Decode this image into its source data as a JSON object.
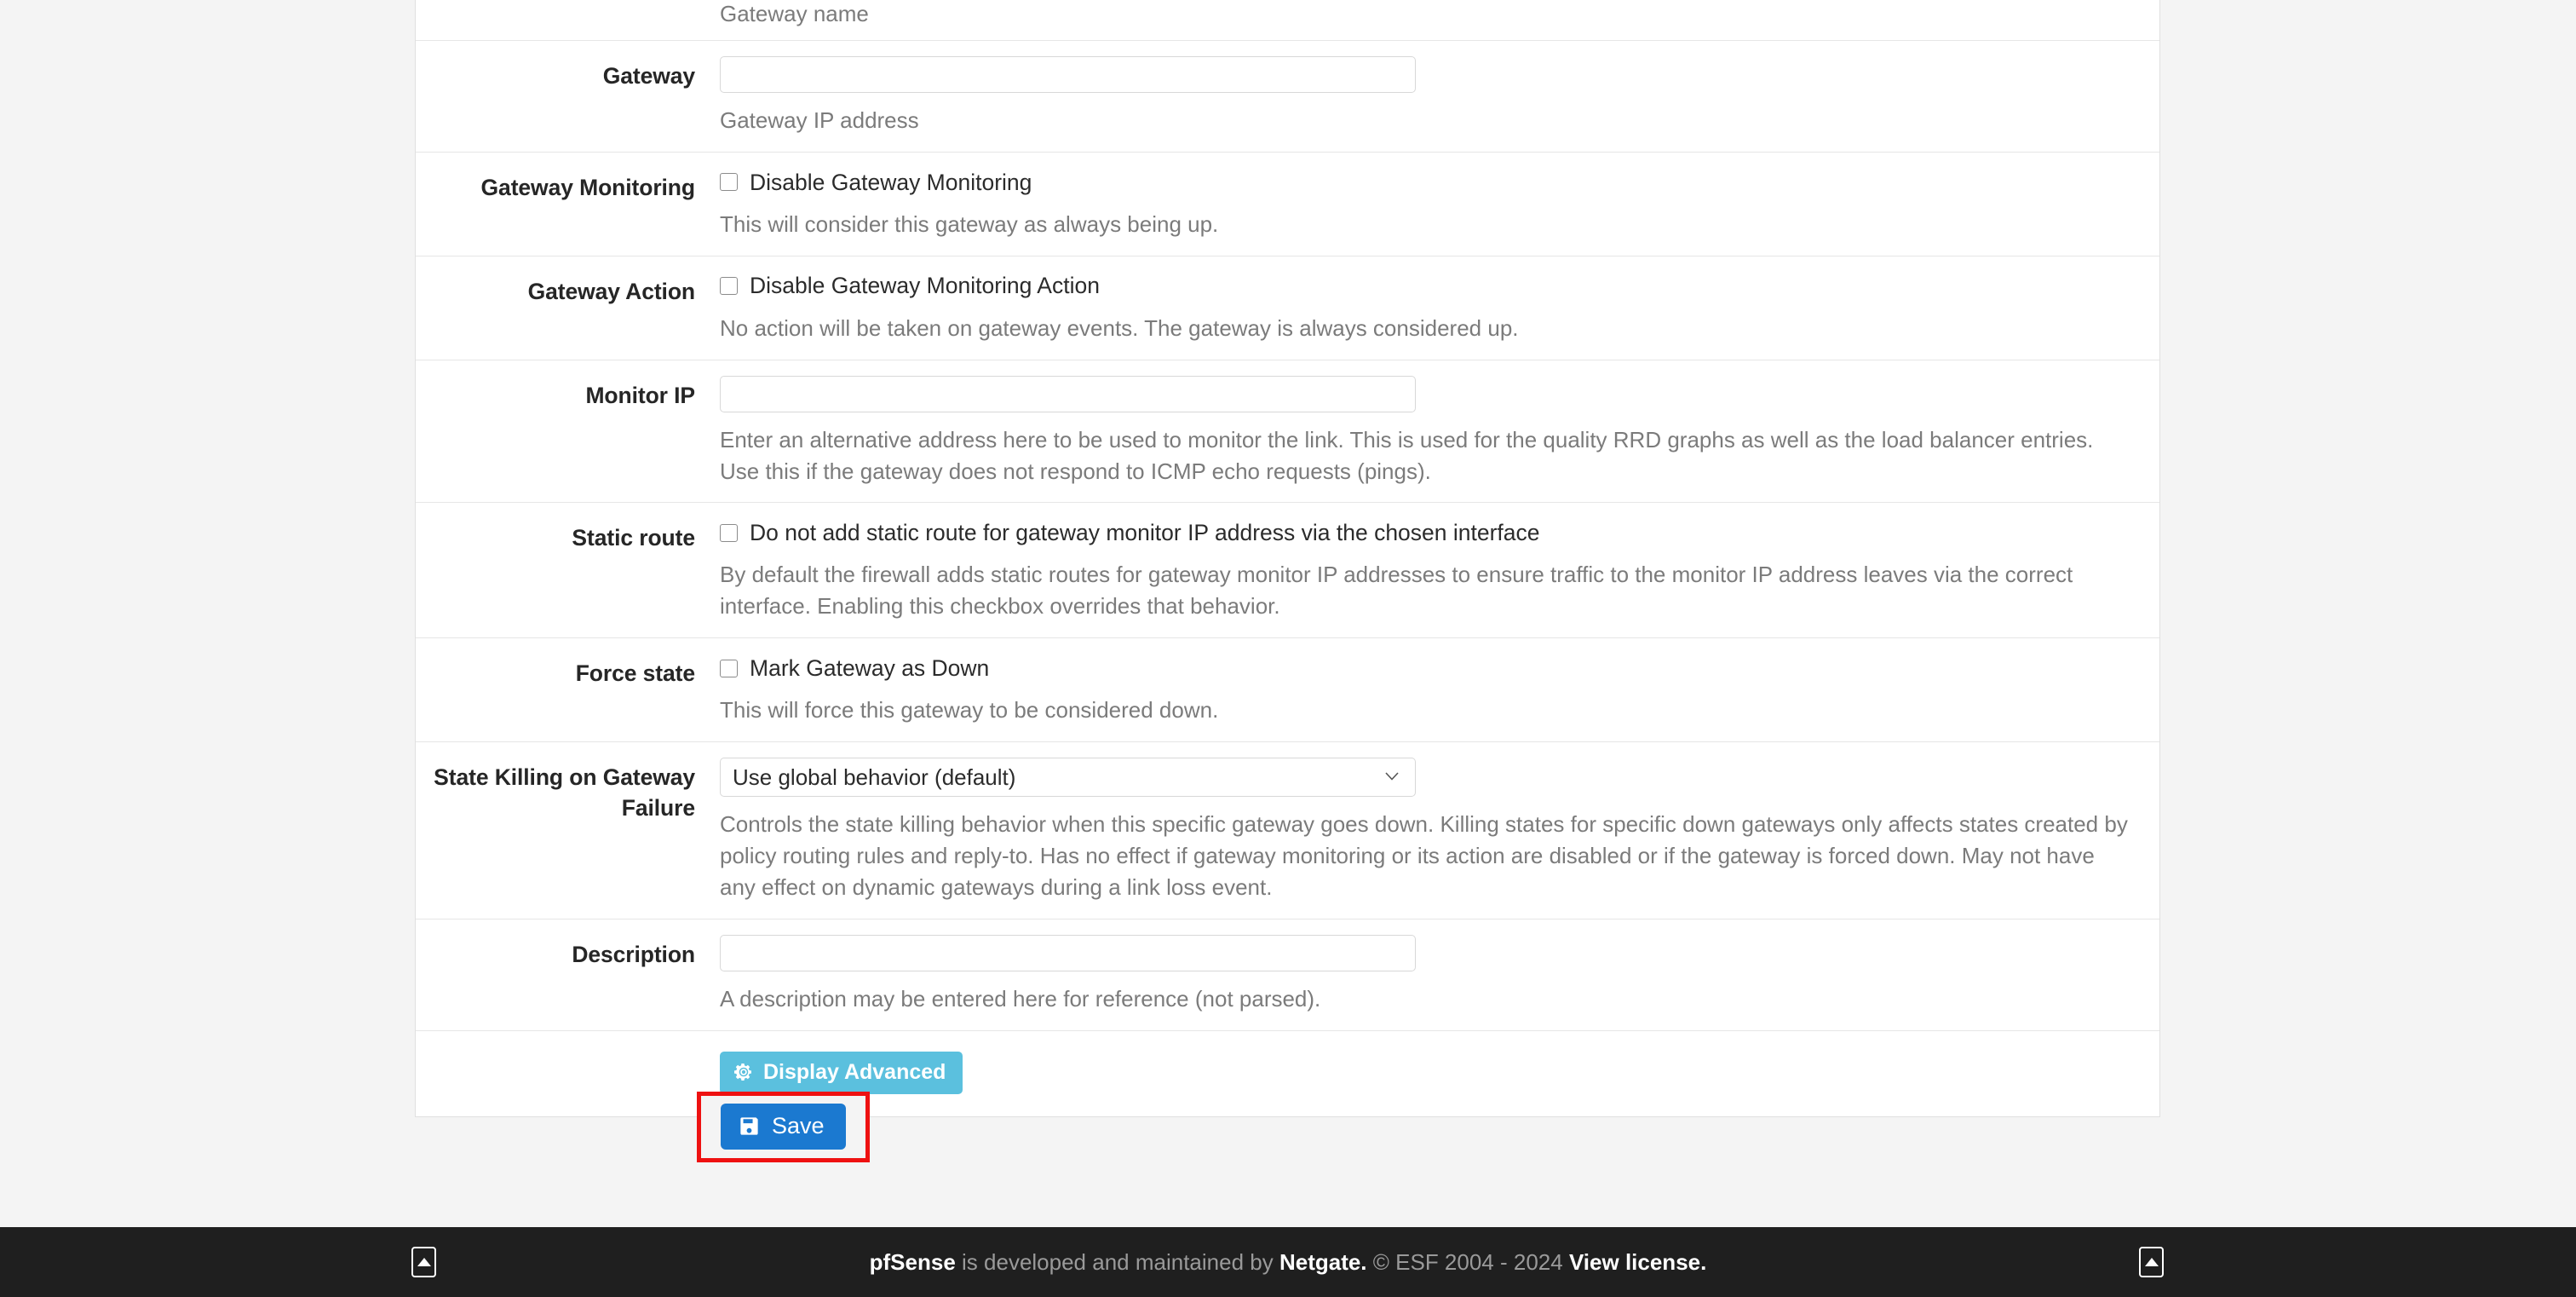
{
  "form": {
    "rows": [
      {
        "id": "name",
        "label": "",
        "control": "none",
        "help": "Gateway name"
      },
      {
        "id": "gateway",
        "label": "Gateway",
        "control": "text",
        "value": "",
        "placeholder": "",
        "help": "Gateway IP address"
      },
      {
        "id": "gateway-monitoring",
        "label": "Gateway Monitoring",
        "control": "checkbox",
        "checkbox_label": "Disable Gateway Monitoring",
        "checked": false,
        "help": "This will consider this gateway as always being up."
      },
      {
        "id": "gateway-action",
        "label": "Gateway Action",
        "control": "checkbox",
        "checkbox_label": "Disable Gateway Monitoring Action",
        "checked": false,
        "help": "No action will be taken on gateway events. The gateway is always considered up."
      },
      {
        "id": "monitor-ip",
        "label": "Monitor IP",
        "control": "text",
        "value": "",
        "placeholder": "",
        "help": "Enter an alternative address here to be used to monitor the link. This is used for the quality RRD graphs as well as the load balancer entries. Use this if the gateway does not respond to ICMP echo requests (pings)."
      },
      {
        "id": "static-route",
        "label": "Static route",
        "control": "checkbox",
        "checkbox_label": "Do not add static route for gateway monitor IP address via the chosen interface",
        "checked": false,
        "help": "By default the firewall adds static routes for gateway monitor IP addresses to ensure traffic to the monitor IP address leaves via the correct interface. Enabling this checkbox overrides that behavior."
      },
      {
        "id": "force-state",
        "label": "Force state",
        "control": "checkbox",
        "checkbox_label": "Mark Gateway as Down",
        "checked": false,
        "help": "This will force this gateway to be considered down."
      },
      {
        "id": "state-killing",
        "label": "State Killing on Gateway Failure",
        "control": "select",
        "value": "Use global behavior (default)",
        "options": [
          "Use global behavior (default)"
        ],
        "help": "Controls the state killing behavior when this specific gateway goes down. Killing states for specific down gateways only affects states created by policy routing rules and reply-to. Has no effect if gateway monitoring or its action are disabled or if the gateway is forced down. May not have any effect on dynamic gateways during a link loss event."
      },
      {
        "id": "description",
        "label": "Description",
        "control": "text",
        "value": "",
        "placeholder": "",
        "help": "A description may be entered here for reference (not parsed)."
      }
    ],
    "display_advanced_label": "Display Advanced",
    "display_advanced_icon": "gear-icon",
    "display_advanced_color": "#5bc0de"
  },
  "actions": {
    "save_label": "Save",
    "save_icon": "floppy-disk-save-icon",
    "save_color": "#1b79d0",
    "highlight_color": "#ee1111"
  },
  "footer": {
    "product": "pfSense",
    "middle": " is developed and maintained by ",
    "vendor": "Netgate.",
    "copyright": " © ESF 2004 - 2024 ",
    "license": "View license.",
    "scroll_up_left_icon": "scroll-to-top-icon",
    "scroll_up_right_icon": "scroll-to-top-icon",
    "background": "#1f1f1f"
  }
}
